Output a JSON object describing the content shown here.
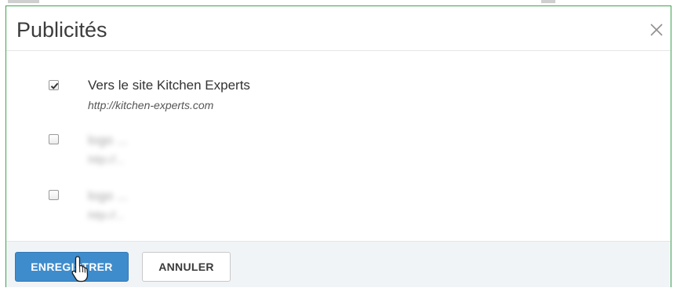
{
  "modal": {
    "title": "Publicités",
    "close_icon": "close-icon",
    "ads": [
      {
        "checked": true,
        "title": "Vers le site Kitchen Experts",
        "url": "http://kitchen-experts.com"
      },
      {
        "checked": false,
        "title": "logo ...",
        "url": "http://...",
        "blurred": true
      },
      {
        "checked": false,
        "title": "logo ...",
        "url": "http://...",
        "blurred": true
      }
    ]
  },
  "footer": {
    "save_label": "ENREGISTRER",
    "cancel_label": "ANNULER"
  },
  "colors": {
    "primary_button": "#3f8ccc",
    "modal_border": "#3fa34d",
    "footer_bg": "#f1f4f7"
  },
  "icons": {
    "cursor": "hand-pointer-icon",
    "check": "checkmark-icon"
  }
}
